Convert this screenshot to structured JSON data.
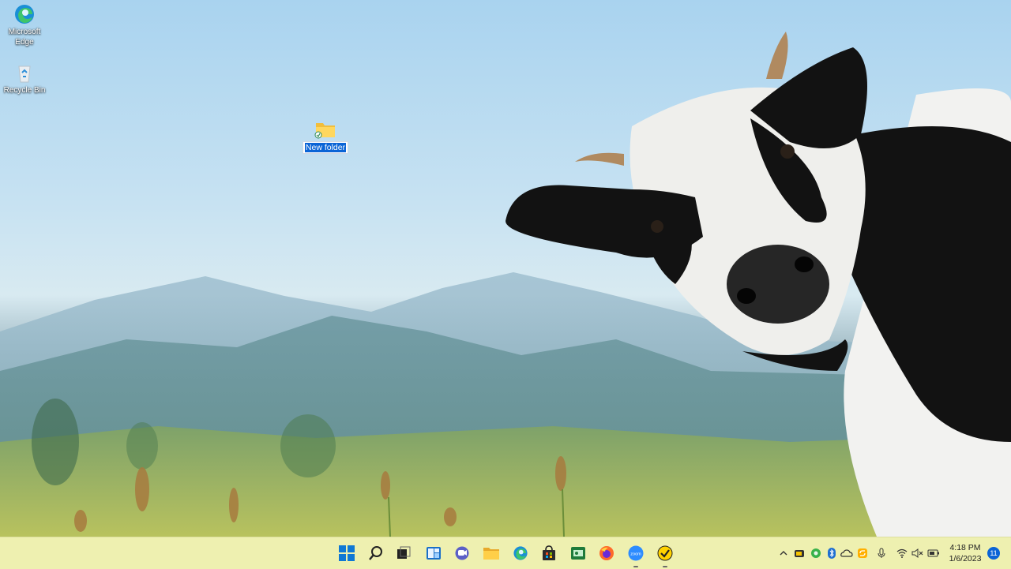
{
  "desktop": {
    "icons": [
      {
        "label": "Microsoft Edge",
        "icon": "edge-icon"
      },
      {
        "label": "Recycle Bin",
        "icon": "recycle-bin-icon"
      }
    ],
    "new_folder": {
      "label": "New folder",
      "state": "renaming"
    }
  },
  "taskbar": {
    "apps": [
      {
        "name": "start",
        "icon": "windows-start-icon"
      },
      {
        "name": "search",
        "icon": "search-icon"
      },
      {
        "name": "task-view",
        "icon": "task-view-icon"
      },
      {
        "name": "widgets",
        "icon": "widgets-icon"
      },
      {
        "name": "chat",
        "icon": "chat-icon"
      },
      {
        "name": "file-explorer",
        "icon": "folder-icon"
      },
      {
        "name": "edge",
        "icon": "edge-icon"
      },
      {
        "name": "store",
        "icon": "store-icon"
      },
      {
        "name": "game",
        "icon": "game-icon"
      },
      {
        "name": "firefox",
        "icon": "firefox-icon"
      },
      {
        "name": "zoom",
        "icon": "zoom-icon",
        "label": "zoom",
        "running": true
      },
      {
        "name": "norton",
        "icon": "checkmark-badge-icon",
        "running": true
      }
    ],
    "tray": {
      "icons": [
        "chevron-up-icon",
        "battery-app-icon",
        "green-app-icon",
        "bluetooth-icon",
        "cloud-icon",
        "sync-icon",
        "microphone-icon",
        "wifi-icon",
        "speaker-muted-icon",
        "battery-icon"
      ],
      "time": "4:18 PM",
      "date": "1/6/2023",
      "notification_count": "11"
    }
  },
  "colors": {
    "taskbar": "#eef0b0",
    "selection": "#0a64d6"
  }
}
